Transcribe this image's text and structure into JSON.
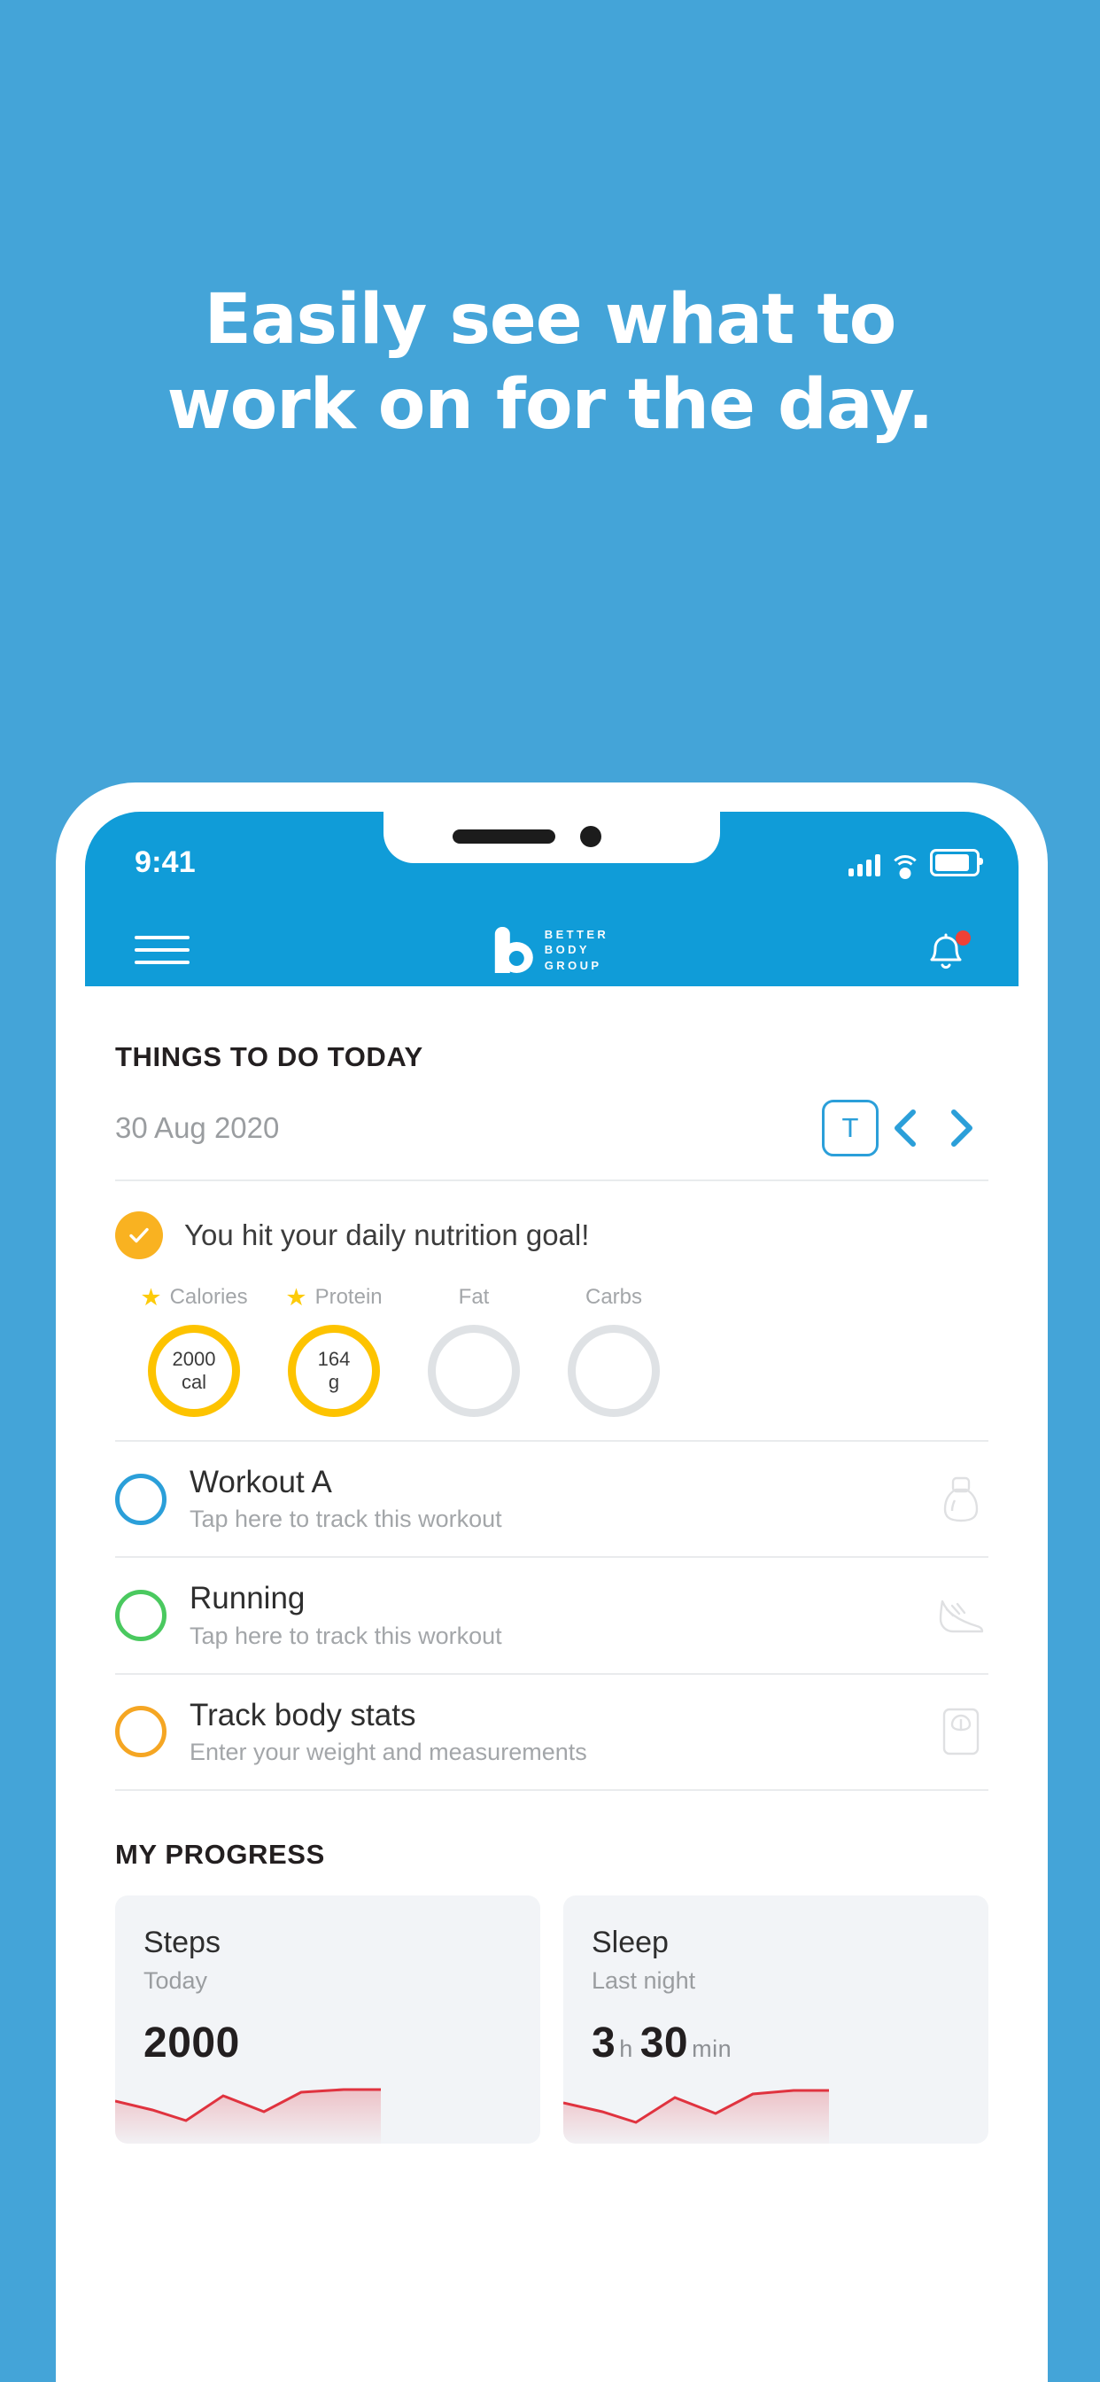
{
  "promo": {
    "line1": "Easily see what to",
    "line2": "work on for the day.",
    "bg_color": "#44a4d8"
  },
  "status_bar": {
    "time": "9:41",
    "signal_icon": "cellular-signal-icon",
    "wifi_icon": "wifi-icon",
    "battery_icon": "battery-icon"
  },
  "app_bar": {
    "menu_icon": "hamburger-menu-icon",
    "logo_mark": "letter-b-logo",
    "logo_line1": "BETTER",
    "logo_line2": "BODY",
    "logo_line3": "GROUP",
    "notification_icon": "bell-icon",
    "has_notification": true,
    "brand_color": "#109cd8"
  },
  "todo": {
    "section_title": "THINGS TO DO TODAY",
    "date": "30 Aug 2020",
    "today_button": "T",
    "prev_label": "Previous day",
    "next_label": "Next day"
  },
  "nutrition": {
    "message": "You hit your daily nutrition goal!",
    "check_color": "#f9b221",
    "macros": [
      {
        "label": "Calories",
        "starred": true,
        "value": "2000",
        "unit": "cal",
        "complete": true
      },
      {
        "label": "Protein",
        "starred": true,
        "value": "164",
        "unit": "g",
        "complete": true
      },
      {
        "label": "Fat",
        "starred": false,
        "value": "",
        "unit": "",
        "complete": false
      },
      {
        "label": "Carbs",
        "starred": false,
        "value": "",
        "unit": "",
        "complete": false
      }
    ]
  },
  "tasks": [
    {
      "name": "Workout A",
      "subtitle": "Tap here to track this workout",
      "color": "#2b9fd9",
      "icon": "kettlebell-icon"
    },
    {
      "name": "Running",
      "subtitle": "Tap here to track this workout",
      "color": "#4ac95f",
      "icon": "running-shoe-icon"
    },
    {
      "name": "Track body stats",
      "subtitle": "Enter your weight and measurements",
      "color": "#f5a623",
      "icon": "weight-scale-icon"
    }
  ],
  "progress": {
    "section_title": "MY PROGRESS",
    "cards": [
      {
        "title": "Steps",
        "period": "Today",
        "value": "2000",
        "unit": "",
        "value2": "",
        "unit2": ""
      },
      {
        "title": "Sleep",
        "period": "Last night",
        "value": "3",
        "unit": "h",
        "value2": "30",
        "unit2": "min"
      }
    ],
    "spark_color": "#e0333f"
  }
}
